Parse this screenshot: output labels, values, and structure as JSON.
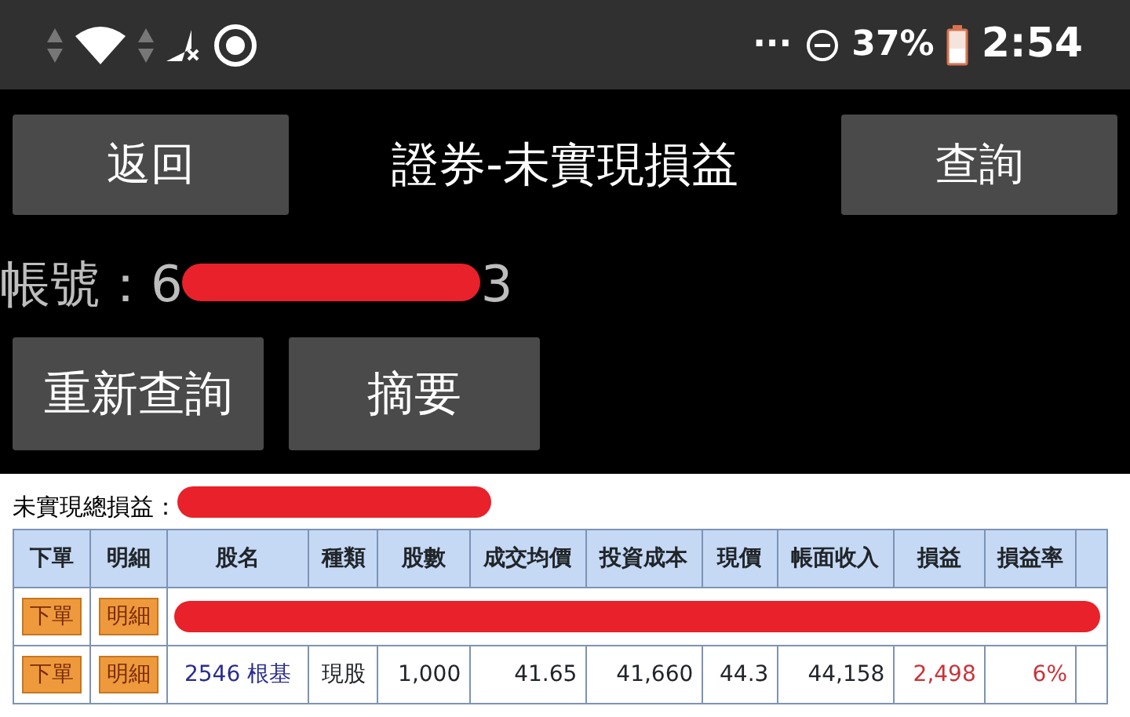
{
  "status_bar": {
    "overflow": "···",
    "battery_percent": "37%",
    "time": "2:54"
  },
  "header": {
    "back": "返回",
    "title": "證券-未實現損益",
    "query": "查詢"
  },
  "account": {
    "label": "帳號：6",
    "suffix": "3",
    "redacted": true
  },
  "actions": [
    "重新查詢",
    "摘要"
  ],
  "summary": {
    "label": "未實現總損益：",
    "redacted": true
  },
  "table": {
    "columns": [
      "下單",
      "明細",
      "股名",
      "種類",
      "股數",
      "成交均價",
      "投資成本",
      "現價",
      "帳面收入",
      "損益",
      "損益率"
    ],
    "rows": [
      {
        "order": "下單",
        "detail": "明細",
        "redacted": true
      },
      {
        "order": "下單",
        "detail": "明細",
        "redacted": false,
        "name": "2546 根基",
        "type": "現股",
        "shares": "1,000",
        "avg_price": "41.65",
        "cost": "41,660",
        "price": "44.3",
        "market_value": "44,158",
        "pnl": "2,498",
        "pnl_rate": "6%",
        "gain": true
      }
    ]
  }
}
